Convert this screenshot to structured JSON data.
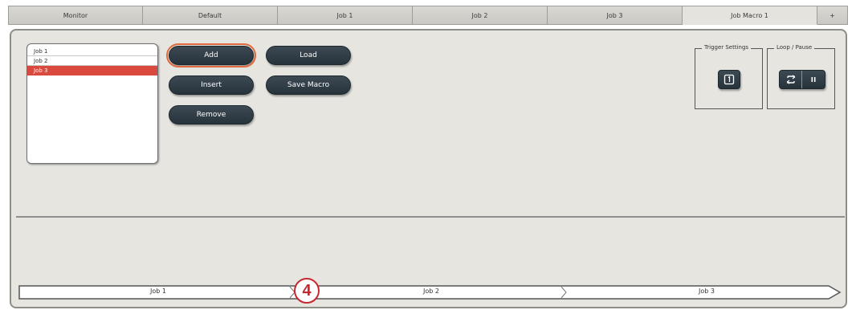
{
  "tabs": [
    {
      "label": "Monitor"
    },
    {
      "label": "Default"
    },
    {
      "label": "Job 1"
    },
    {
      "label": "Job 2"
    },
    {
      "label": "Job 3"
    },
    {
      "label": "Job Macro 1"
    },
    {
      "label": "+"
    }
  ],
  "active_tab": "Job Macro 1",
  "job_list": {
    "items": [
      "Job 1",
      "Job 2",
      "Job 3"
    ],
    "selected": "Job 3"
  },
  "buttons": {
    "add": "Add",
    "load": "Load",
    "insert": "Insert",
    "save_macro": "Save Macro",
    "remove": "Remove"
  },
  "trigger_settings": {
    "title": "Trigger Settings",
    "icon": "trigger-icon"
  },
  "loop_pause": {
    "title": "Loop / Pause",
    "icons": [
      "loop-icon",
      "pause-icon"
    ]
  },
  "timeline": {
    "segments": [
      "Job 1",
      "Job 2",
      "Job 3"
    ]
  },
  "callout": {
    "number": "4"
  },
  "colors": {
    "selection": "#d9493d",
    "button": "#2f3c45",
    "callout": "#c5272e",
    "panel": "#e6e5e0"
  }
}
